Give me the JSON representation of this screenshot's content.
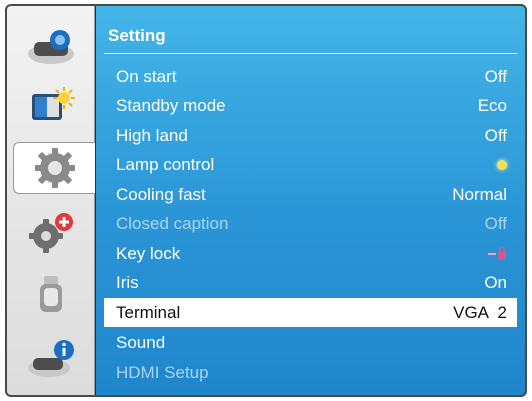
{
  "menu": {
    "title": "Setting",
    "items": [
      {
        "label": "On start",
        "value": "Off",
        "state": "normal"
      },
      {
        "label": "Standby mode",
        "value": "Eco",
        "state": "normal"
      },
      {
        "label": "High land",
        "value": "Off",
        "state": "normal"
      },
      {
        "label": "Lamp control",
        "value": "",
        "icon": "lamp-bulb-icon",
        "state": "normal"
      },
      {
        "label": "Cooling fast",
        "value": "Normal",
        "state": "normal"
      },
      {
        "label": "Closed caption",
        "value": "Off",
        "state": "disabled"
      },
      {
        "label": "Key lock",
        "value": "",
        "icon": "key-lock-icon",
        "state": "normal"
      },
      {
        "label": "Iris",
        "value": "On",
        "state": "normal"
      },
      {
        "label": "Terminal",
        "value": "VGA  2",
        "state": "selected"
      },
      {
        "label": "Sound",
        "value": "",
        "state": "normal"
      },
      {
        "label": "HDMI Setup",
        "value": "",
        "state": "disabled"
      }
    ]
  },
  "sidebar": {
    "active_index": 2,
    "icons": [
      "projector-icon",
      "image-adjust-icon",
      "setting-gear-icon",
      "expand-gear-icon",
      "memory-viewer-icon",
      "information-icon"
    ]
  },
  "colors": {
    "menu_top": "#43b5e8",
    "menu_bottom": "#1f86cc",
    "selected_row_bg": "#ffffff",
    "disabled_text": "#a9d4ef",
    "frame": "#4a4a4a"
  }
}
